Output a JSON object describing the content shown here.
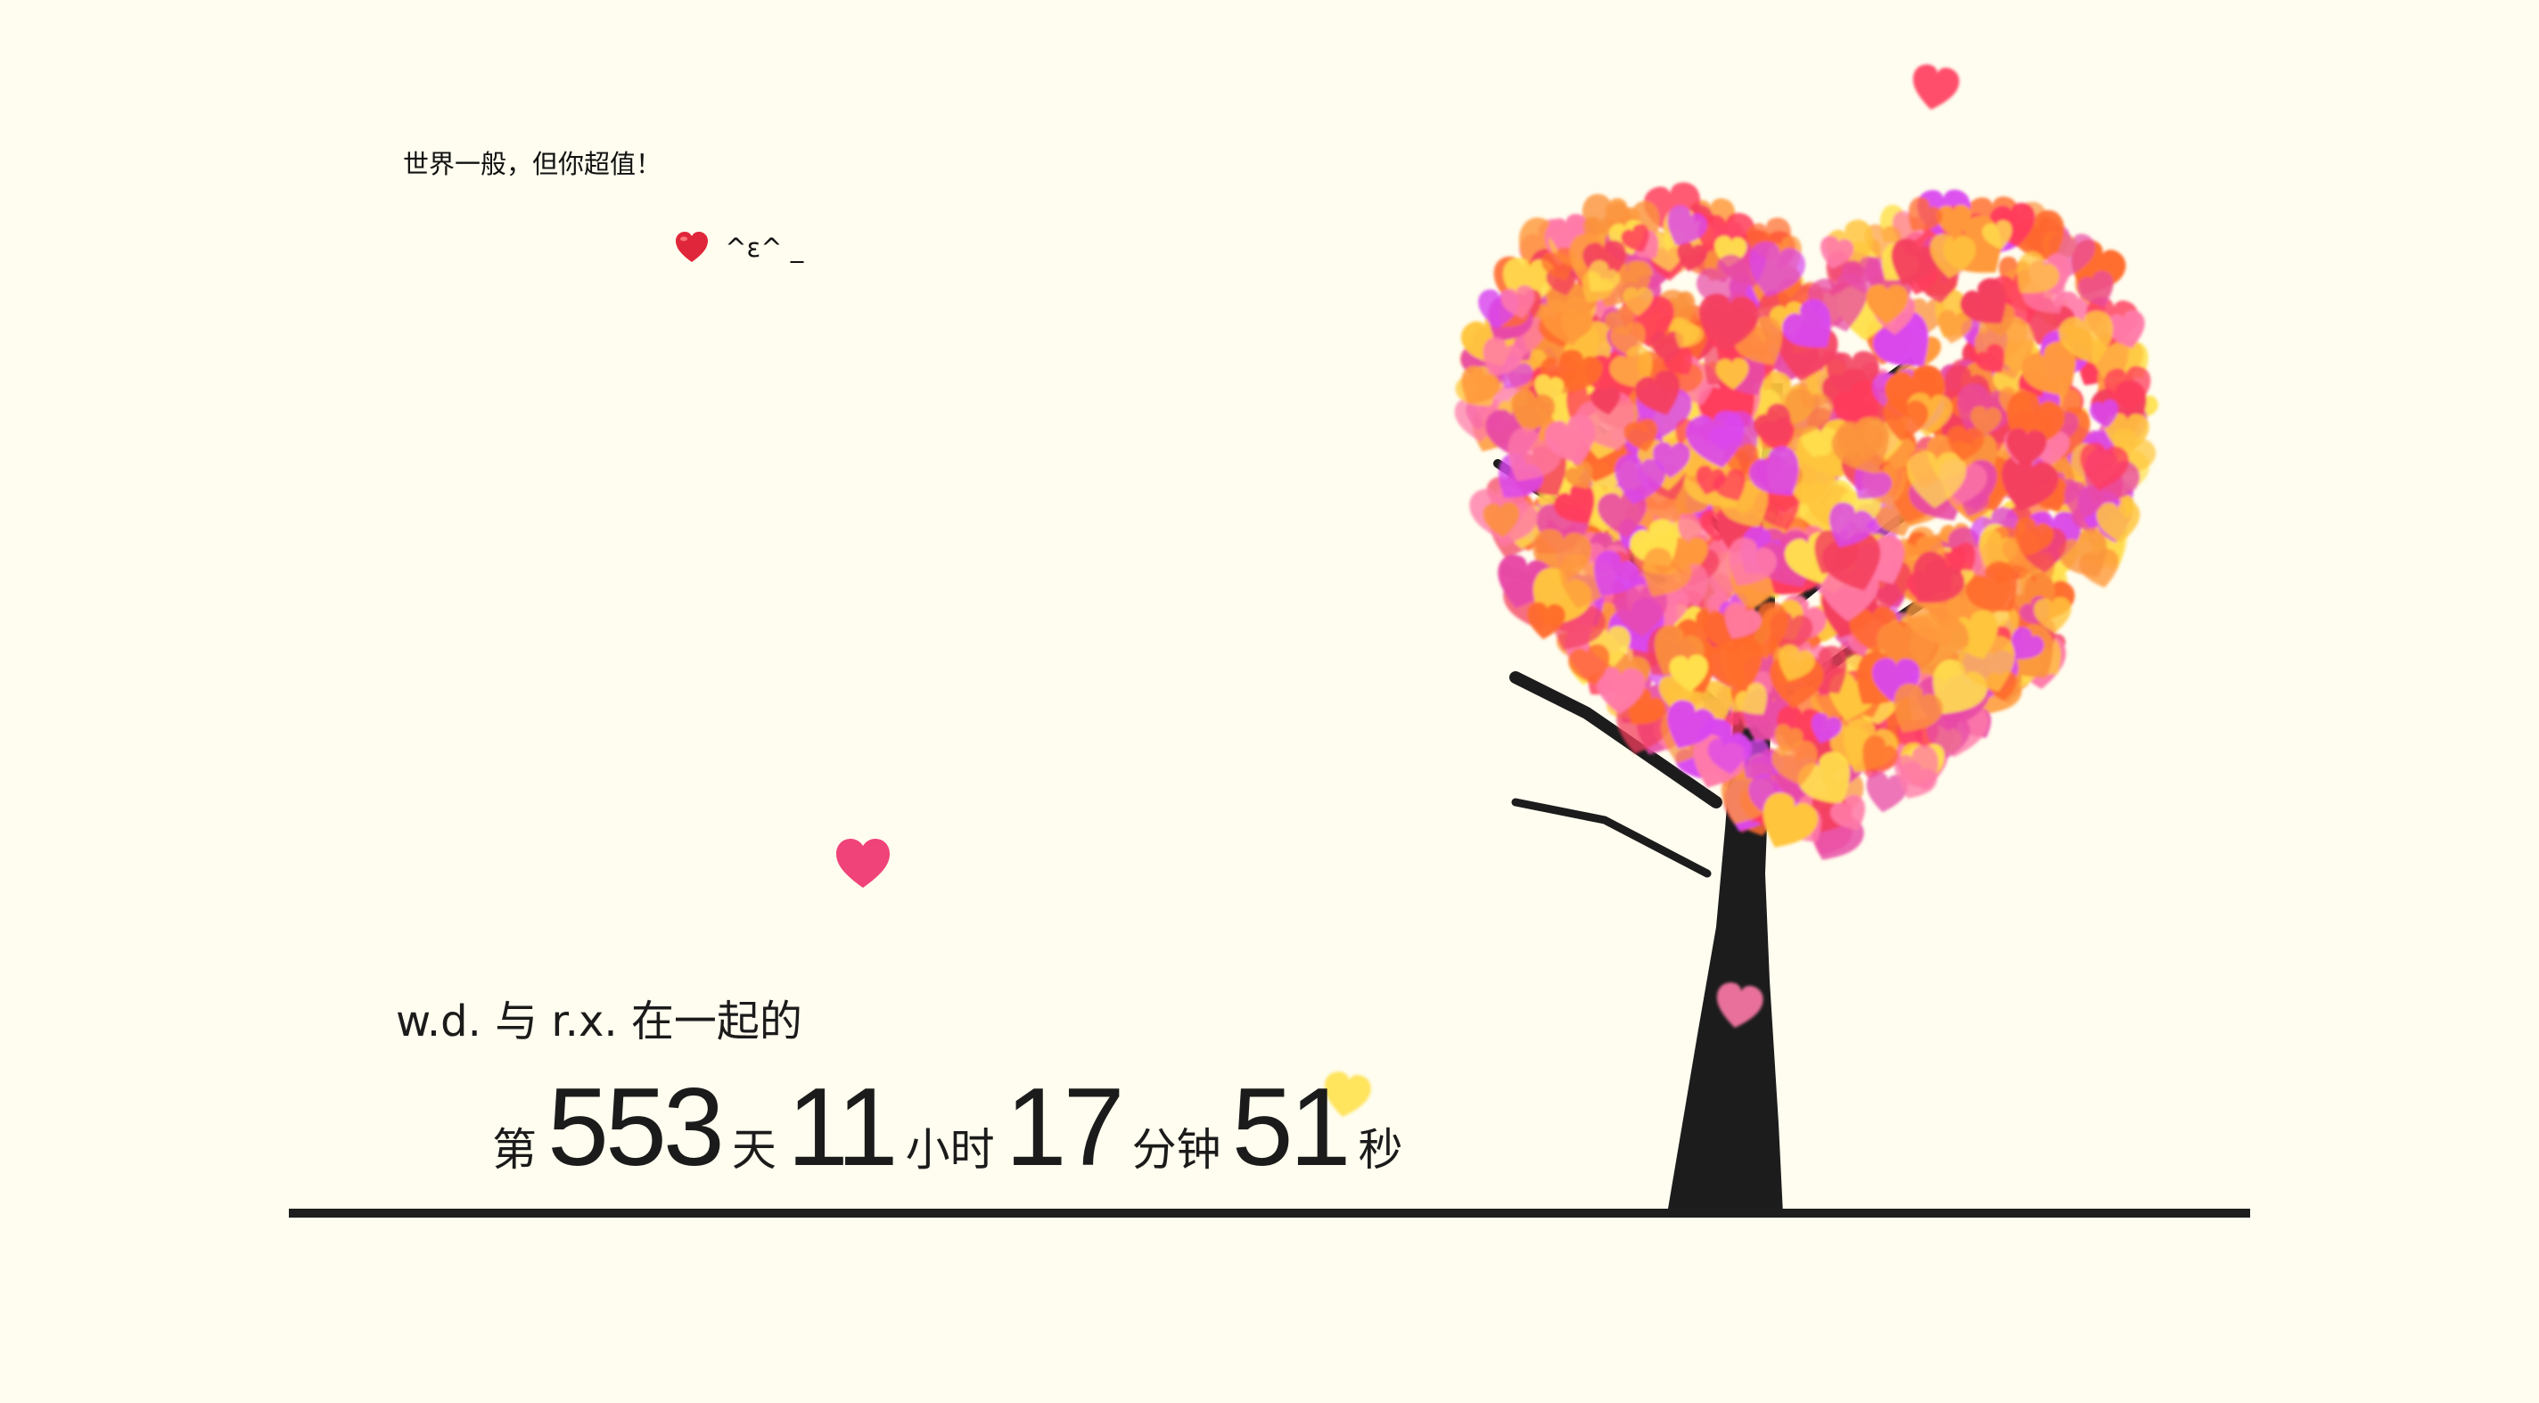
{
  "message": {
    "tagline": "世界一般，但你超值！",
    "emote_text": "^ε^ _"
  },
  "counter": {
    "caption": "w.d. 与 r.x. 在一起的",
    "prefix": "第",
    "days": "553",
    "days_unit": "天",
    "hours": "11",
    "hours_unit": "小时",
    "minutes": "17",
    "minutes_unit": "分钟",
    "seconds": "51",
    "seconds_unit": "秒"
  },
  "colors": {
    "background": "#fffdef",
    "heart_palette": [
      "#ff3b5c",
      "#ff6b2c",
      "#ff9a3c",
      "#ffc53d",
      "#ffe14d",
      "#e84aa6",
      "#d946ef",
      "#ff7aa8",
      "#f43f5e",
      "#fb923c"
    ],
    "trunk": "#1c1c1c",
    "floating_heart": "#f0437a"
  },
  "icons": {
    "emote_icon": "red-heart-emoji",
    "floating_icon": "heart-icon",
    "tree_icon": "heart-tree"
  }
}
